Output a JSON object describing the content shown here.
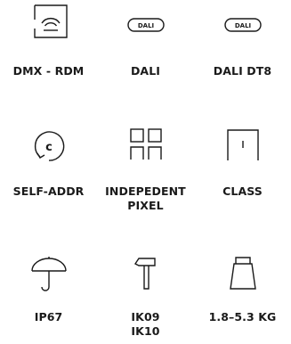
{
  "features": [
    {
      "label": "DMX - RDM",
      "icon": "dmx-rdm-icon"
    },
    {
      "label": "DALI",
      "icon": "dali-badge-icon",
      "badge_text": "DALI"
    },
    {
      "label": "DALI DT8",
      "icon": "dali-badge-icon",
      "badge_text": "DALI"
    },
    {
      "label": "SELF-ADDR",
      "icon": "self-address-icon",
      "icon_glyph": "c"
    },
    {
      "label": "INDEPEDENT\nPIXEL",
      "icon": "pixel-grid-icon"
    },
    {
      "label": "CLASS",
      "icon": "class-icon"
    },
    {
      "label": "IP67",
      "icon": "umbrella-icon"
    },
    {
      "label": "IK09\nIK10",
      "icon": "hammer-icon"
    },
    {
      "label": "1.8–5.3 KG",
      "icon": "weight-icon"
    }
  ],
  "colors": {
    "text": "#1a1a1a",
    "stroke": "#1a1a1a",
    "background": "#ffffff"
  }
}
